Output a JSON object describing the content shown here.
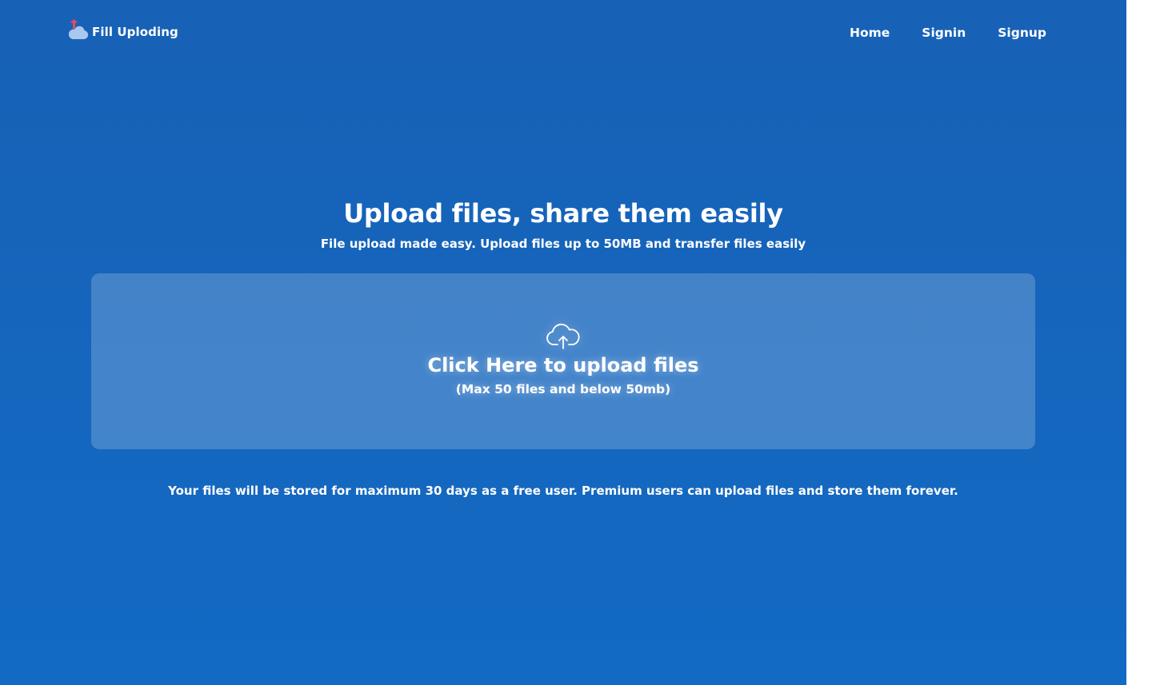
{
  "brand": {
    "name": "Fill Uploding",
    "icon": "cloud-upload-logo-icon"
  },
  "nav": {
    "items": [
      {
        "label": "Home"
      },
      {
        "label": "Signin"
      },
      {
        "label": "Signup"
      }
    ]
  },
  "hero": {
    "title": "Upload files, share them easily",
    "subtitle": "File upload made easy. Upload files up to 50MB and transfer files easily"
  },
  "upload": {
    "icon": "cloud-upload-icon",
    "title": "Click Here to upload files",
    "limits": "(Max 50 files and below 50mb)"
  },
  "footer": {
    "note": "Your files will be stored for maximum 30 days as a free user. Premium users can upload files and store them forever."
  },
  "colors": {
    "background": "#1566bd",
    "upload_box": "rgba(255,255,255,0.2)",
    "logo_arrow": "#e94a5b",
    "logo_cloud": "#a9c8ef",
    "text": "#ffffff"
  }
}
